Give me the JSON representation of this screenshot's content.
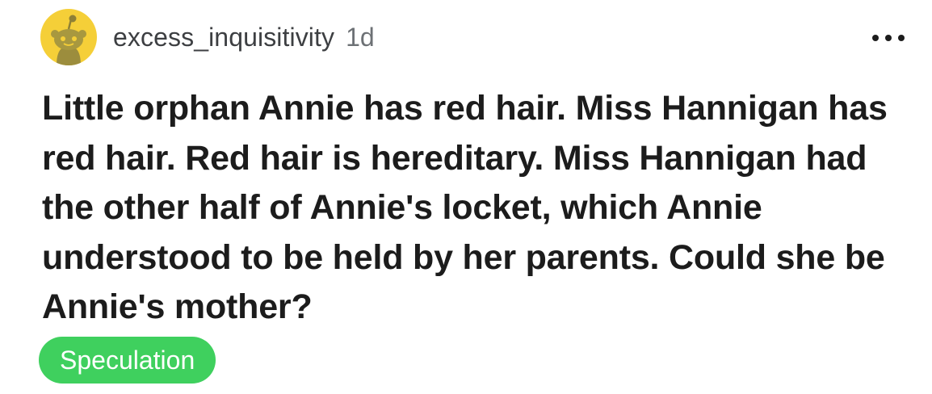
{
  "post": {
    "author": "excess_inquisitivity",
    "age": "1d",
    "title": "Little orphan Annie has red hair. Miss Hannigan has red hair. Red hair is hereditary. Miss Hannigan had the other half of Annie's locket, which Annie understood to be held by her parents. Could she be Annie's mother?",
    "flair": "Speculation",
    "avatar_icon": "snoo-avatar-icon",
    "menu_icon": "more-options-icon"
  },
  "colors": {
    "avatar_background": "#f5cf38",
    "flair_background": "#3fd05e",
    "flair_text": "#ffffff",
    "title_text": "#1c1c1c",
    "meta_text": "#6d7175"
  }
}
